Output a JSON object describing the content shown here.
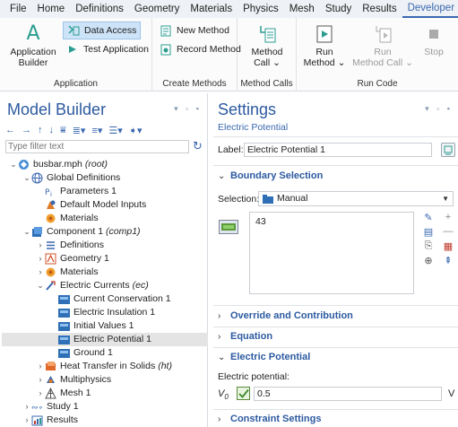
{
  "menu": [
    "File",
    "Home",
    "Definitions",
    "Geometry",
    "Materials",
    "Physics",
    "Mesh",
    "Study",
    "Results",
    "Developer"
  ],
  "menu_active": "Developer",
  "ribbon": {
    "application_builder": "Application\nBuilder",
    "data_access": "Data Access",
    "test_application": "Test Application",
    "group_application": "Application",
    "new_method": "New Method",
    "record_method": "Record Method",
    "group_create_methods": "Create Methods",
    "method_call": "Method\nCall ⌄",
    "group_method_calls": "Method Calls",
    "run_method": "Run\nMethod ⌄",
    "run_method_call": "Run\nMethod Call ⌄",
    "stop": "Stop",
    "group_run_code": "Run Code"
  },
  "model_builder": {
    "title": "Model Builder",
    "filter_placeholder": "Type filter text",
    "tree": [
      {
        "label": "busbar.mph",
        "suffix": "(root)",
        "icon": "root-icon",
        "indent": 0,
        "arrow": "⌄"
      },
      {
        "label": "Global Definitions",
        "suffix": "",
        "icon": "globe-icon",
        "indent": 1,
        "arrow": "⌄"
      },
      {
        "label": "Parameters 1",
        "suffix": "",
        "icon": "parameters-icon",
        "indent": 2,
        "arrow": ""
      },
      {
        "label": "Default Model Inputs",
        "suffix": "",
        "icon": "model-inputs-icon",
        "indent": 2,
        "arrow": ""
      },
      {
        "label": "Materials",
        "suffix": "",
        "icon": "materials-icon",
        "indent": 2,
        "arrow": ""
      },
      {
        "label": "Component 1",
        "suffix": "(comp1)",
        "icon": "component-icon",
        "indent": 1,
        "arrow": "⌄"
      },
      {
        "label": "Definitions",
        "suffix": "",
        "icon": "definitions-icon",
        "indent": 2,
        "arrow": "›"
      },
      {
        "label": "Geometry 1",
        "suffix": "",
        "icon": "geometry-icon",
        "indent": 2,
        "arrow": "›"
      },
      {
        "label": "Materials",
        "suffix": "",
        "icon": "materials-icon",
        "indent": 2,
        "arrow": "›"
      },
      {
        "label": "Electric Currents",
        "suffix": "(ec)",
        "icon": "electric-currents-icon",
        "indent": 2,
        "arrow": "⌄"
      },
      {
        "label": "Current Conservation 1",
        "suffix": "",
        "icon": "boundary-condition-icon",
        "indent": 3,
        "arrow": ""
      },
      {
        "label": "Electric Insulation 1",
        "suffix": "",
        "icon": "boundary-condition-icon",
        "indent": 3,
        "arrow": ""
      },
      {
        "label": "Initial Values 1",
        "suffix": "",
        "icon": "boundary-condition-icon",
        "indent": 3,
        "arrow": ""
      },
      {
        "label": "Electric Potential 1",
        "suffix": "",
        "icon": "boundary-condition-icon",
        "indent": 3,
        "arrow": "",
        "selected": true
      },
      {
        "label": "Ground 1",
        "suffix": "",
        "icon": "boundary-condition-icon",
        "indent": 3,
        "arrow": ""
      },
      {
        "label": "Heat Transfer in Solids",
        "suffix": "(ht)",
        "icon": "heat-transfer-icon",
        "indent": 2,
        "arrow": "›"
      },
      {
        "label": "Multiphysics",
        "suffix": "",
        "icon": "multiphysics-icon",
        "indent": 2,
        "arrow": "›"
      },
      {
        "label": "Mesh 1",
        "suffix": "",
        "icon": "mesh-icon",
        "indent": 2,
        "arrow": "›"
      },
      {
        "label": "Study 1",
        "suffix": "",
        "icon": "study-icon",
        "indent": 1,
        "arrow": "›"
      },
      {
        "label": "Results",
        "suffix": "",
        "icon": "results-icon",
        "indent": 1,
        "arrow": "›"
      }
    ]
  },
  "settings": {
    "title": "Settings",
    "subtitle": "Electric Potential",
    "label_caption": "Label:",
    "label_value": "Electric Potential 1",
    "boundary_selection": "Boundary Selection",
    "selection_caption": "Selection:",
    "selection_value": "Manual",
    "selection_list_value": "43",
    "override": "Override and Contribution",
    "equation": "Equation",
    "electric_potential_section": "Electric Potential",
    "electric_potential_caption": "Electric potential:",
    "v0_symbol": "V",
    "v0_sub": "0",
    "v0_value": "0.5",
    "v0_unit": "V",
    "constraint_settings": "Constraint Settings"
  },
  "colors": {
    "accent": "#2c5aa0",
    "menu_active": "#3a68b0",
    "selection": "#e4e4e4"
  }
}
